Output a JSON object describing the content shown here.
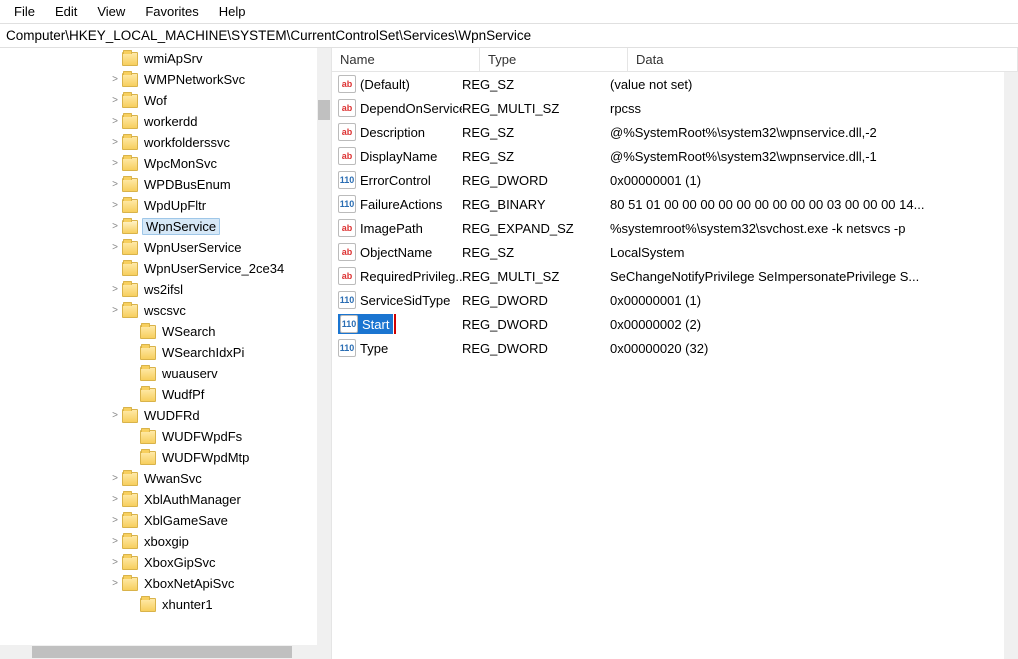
{
  "menu": {
    "file": "File",
    "edit": "Edit",
    "view": "View",
    "favorites": "Favorites",
    "help": "Help"
  },
  "address": "Computer\\HKEY_LOCAL_MACHINE\\SYSTEM\\CurrentControlSet\\Services\\WpnService",
  "tree": [
    {
      "label": "wmiApSrv",
      "chev": "",
      "indent": 0
    },
    {
      "label": "WMPNetworkSvc",
      "chev": ">",
      "indent": 0
    },
    {
      "label": "Wof",
      "chev": ">",
      "indent": 0
    },
    {
      "label": "workerdd",
      "chev": ">",
      "indent": 0
    },
    {
      "label": "workfolderssvc",
      "chev": ">",
      "indent": 0
    },
    {
      "label": "WpcMonSvc",
      "chev": ">",
      "indent": 0
    },
    {
      "label": "WPDBusEnum",
      "chev": ">",
      "indent": 0
    },
    {
      "label": "WpdUpFltr",
      "chev": ">",
      "indent": 0
    },
    {
      "label": "WpnService",
      "chev": ">",
      "indent": 0,
      "selected": true
    },
    {
      "label": "WpnUserService",
      "chev": ">",
      "indent": 0
    },
    {
      "label": "WpnUserService_2ce34",
      "chev": "",
      "indent": 0
    },
    {
      "label": "ws2ifsl",
      "chev": ">",
      "indent": 0
    },
    {
      "label": "wscsvc",
      "chev": ">",
      "indent": 0
    },
    {
      "label": "WSearch",
      "chev": "",
      "indent": 1
    },
    {
      "label": "WSearchIdxPi",
      "chev": "",
      "indent": 1
    },
    {
      "label": "wuauserv",
      "chev": "",
      "indent": 1
    },
    {
      "label": "WudfPf",
      "chev": "",
      "indent": 1
    },
    {
      "label": "WUDFRd",
      "chev": ">",
      "indent": 0
    },
    {
      "label": "WUDFWpdFs",
      "chev": "",
      "indent": 1
    },
    {
      "label": "WUDFWpdMtp",
      "chev": "",
      "indent": 1
    },
    {
      "label": "WwanSvc",
      "chev": ">",
      "indent": 0
    },
    {
      "label": "XblAuthManager",
      "chev": ">",
      "indent": 0
    },
    {
      "label": "XblGameSave",
      "chev": ">",
      "indent": 0
    },
    {
      "label": "xboxgip",
      "chev": ">",
      "indent": 0
    },
    {
      "label": "XboxGipSvc",
      "chev": ">",
      "indent": 0
    },
    {
      "label": "XboxNetApiSvc",
      "chev": ">",
      "indent": 0
    },
    {
      "label": "xhunter1",
      "chev": "",
      "indent": 1
    }
  ],
  "columns": {
    "name": "Name",
    "type": "Type",
    "data": "Data"
  },
  "values": [
    {
      "icon": "sz",
      "name": "(Default)",
      "type": "REG_SZ",
      "data": "(value not set)"
    },
    {
      "icon": "sz",
      "name": "DependOnService",
      "type": "REG_MULTI_SZ",
      "data": "rpcss"
    },
    {
      "icon": "sz",
      "name": "Description",
      "type": "REG_SZ",
      "data": "@%SystemRoot%\\system32\\wpnservice.dll,-2"
    },
    {
      "icon": "sz",
      "name": "DisplayName",
      "type": "REG_SZ",
      "data": "@%SystemRoot%\\system32\\wpnservice.dll,-1"
    },
    {
      "icon": "dw",
      "name": "ErrorControl",
      "type": "REG_DWORD",
      "data": "0x00000001 (1)"
    },
    {
      "icon": "dw",
      "name": "FailureActions",
      "type": "REG_BINARY",
      "data": "80 51 01 00 00 00 00 00 00 00 00 00 03 00 00 00 14..."
    },
    {
      "icon": "sz",
      "name": "ImagePath",
      "type": "REG_EXPAND_SZ",
      "data": "%systemroot%\\system32\\svchost.exe -k netsvcs -p"
    },
    {
      "icon": "sz",
      "name": "ObjectName",
      "type": "REG_SZ",
      "data": "LocalSystem"
    },
    {
      "icon": "sz",
      "name": "RequiredPrivileg...",
      "type": "REG_MULTI_SZ",
      "data": "SeChangeNotifyPrivilege SeImpersonatePrivilege S..."
    },
    {
      "icon": "dw",
      "name": "ServiceSidType",
      "type": "REG_DWORD",
      "data": "0x00000001 (1)"
    },
    {
      "icon": "dw",
      "name": "Start",
      "type": "REG_DWORD",
      "data": "0x00000002 (2)",
      "selected": true
    },
    {
      "icon": "dw",
      "name": "Type",
      "type": "REG_DWORD",
      "data": "0x00000020 (32)"
    }
  ]
}
